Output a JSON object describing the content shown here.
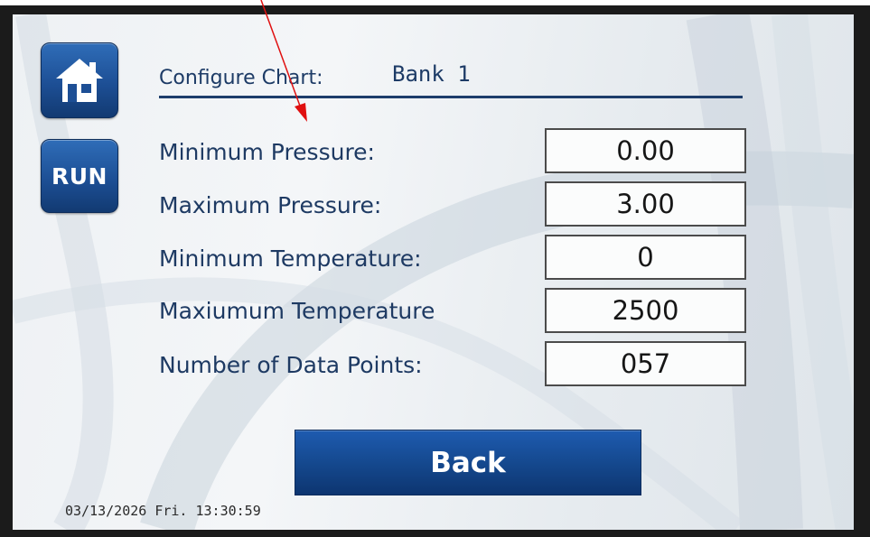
{
  "header": {
    "title_label": "Configure Chart:",
    "title_value": "Bank 1"
  },
  "sidebar": {
    "home_icon": "home-icon",
    "run_label": "RUN"
  },
  "fields": [
    {
      "label": "Minimum Pressure:",
      "value": "0.00"
    },
    {
      "label": "Maximum Pressure:",
      "value": "3.00"
    },
    {
      "label": "Minimum Temperature:",
      "value": "0"
    },
    {
      "label": "Maxiumum Temperature",
      "value": "2500"
    },
    {
      "label": "Number of Data Points:",
      "value": "057"
    }
  ],
  "back_label": "Back",
  "status": {
    "datetime": "03/13/2026  Fri. 13:30:59"
  },
  "colors": {
    "accent_blue": "#1d4f95",
    "label_text": "#1e3a63",
    "annotation_arrow": "#e01010"
  }
}
